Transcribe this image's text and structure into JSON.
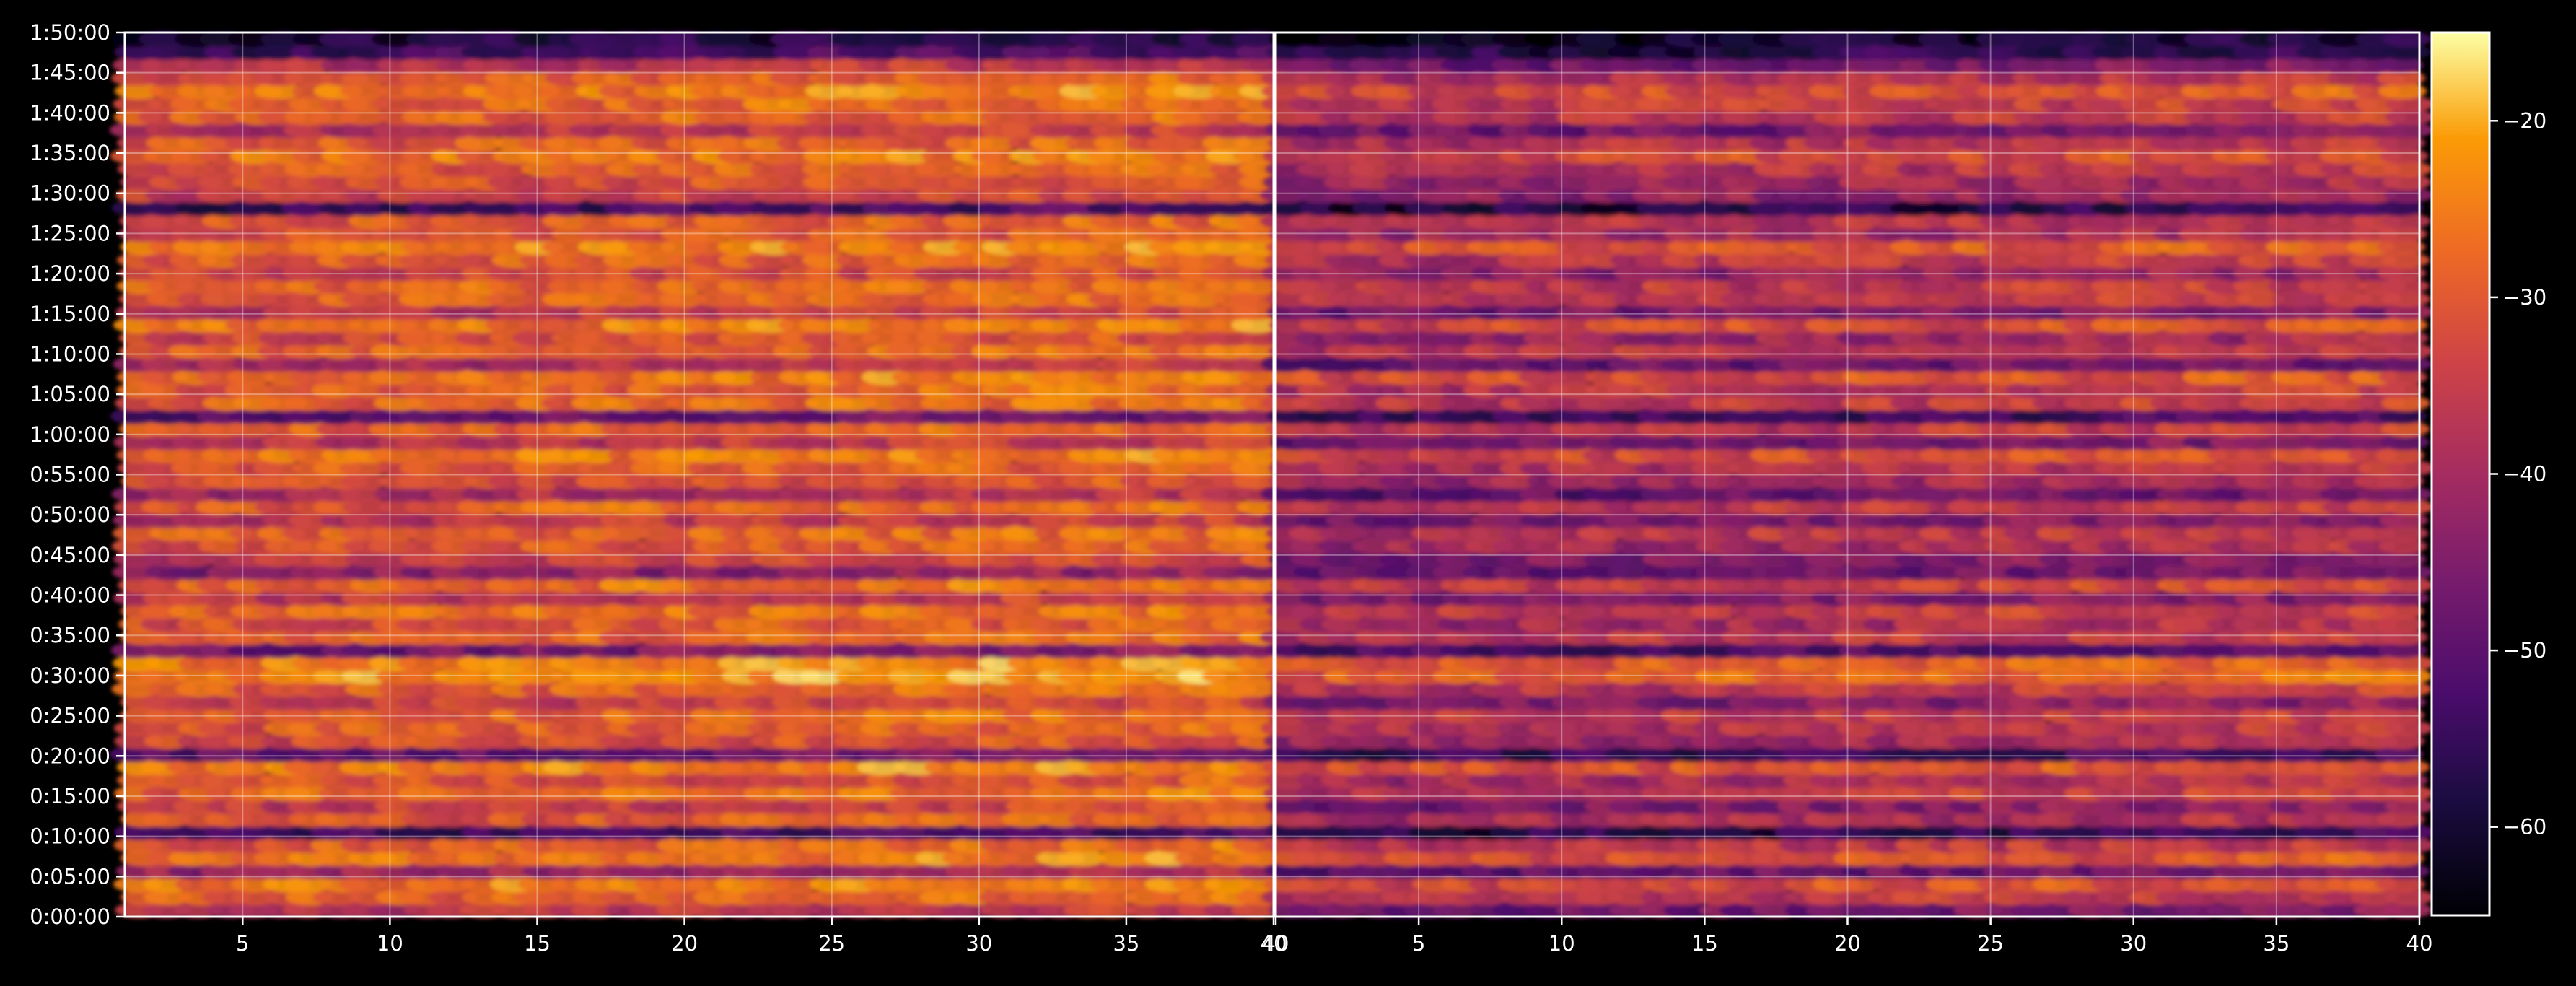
{
  "chart_data": {
    "type": "heatmap",
    "panels": [
      {
        "name": "",
        "xlim": [
          1,
          40
        ],
        "x_ticks": [
          5,
          10,
          15,
          20,
          25,
          30,
          35,
          40
        ],
        "x_tick_labels": [
          "5",
          "10",
          "15",
          "20",
          "25",
          "30",
          "35",
          "40"
        ],
        "ylim_seconds": [
          0,
          6600
        ],
        "grid": true
      },
      {
        "name": "",
        "xlim": [
          0,
          40
        ],
        "x_ticks": [
          5,
          10,
          15,
          20,
          25,
          30,
          35,
          40
        ],
        "x_tick_labels": [
          "40",
          "5",
          "10",
          "15",
          "20",
          "25",
          "30",
          "35",
          "40"
        ],
        "ylim_seconds": [
          0,
          6600
        ],
        "grid": true
      }
    ],
    "y_tick_labels": [
      "0:00:00",
      "0:05:00",
      "0:10:00",
      "0:15:00",
      "0:20:00",
      "0:25:00",
      "0:30:00",
      "0:35:00",
      "0:40:00",
      "0:45:00",
      "0:50:00",
      "0:55:00",
      "1:00:00",
      "1:05:00",
      "1:10:00",
      "1:15:00",
      "1:20:00",
      "1:25:00",
      "1:30:00",
      "1:35:00",
      "1:40:00",
      "1:45:00",
      "1:50:00"
    ],
    "colorbar": {
      "range": [
        -65,
        -15
      ],
      "ticks": [
        -60,
        -50,
        -40,
        -30,
        -20
      ],
      "tick_labels": [
        "−60",
        "−50",
        "−40",
        "−30",
        "−20"
      ],
      "colormap": "inferno"
    },
    "row_levels_note": "Row-wise intensity in dB estimated from color bands, bottom (0:00:00) to top (1:50:00)",
    "row_levels": [
      -38,
      -30,
      -26,
      -42,
      -27,
      -30,
      -55,
      -32,
      -36,
      -29,
      -33,
      -26,
      -50,
      -33,
      -31,
      -29,
      -36,
      -30,
      -24,
      -25,
      -47,
      -30,
      -32,
      -29,
      -37,
      -28,
      -45,
      -36,
      -32,
      -30,
      -37,
      -30,
      -40,
      -33,
      -31,
      -27,
      -38,
      -30,
      -50,
      -29,
      -30,
      -27,
      -40,
      -30,
      -34,
      -27,
      -37,
      -30,
      -29,
      -35,
      -30,
      -26,
      -33,
      -31,
      -55,
      -35,
      -33,
      -31,
      -27,
      -31,
      -38,
      -30,
      -29,
      -27,
      -31,
      -38,
      -55,
      -60
    ],
    "row_offsets_panel2": [
      -10,
      -8,
      -7,
      -8,
      -6,
      -8,
      -3,
      -9,
      -10,
      -8,
      -8,
      -6,
      -6,
      -9,
      -8,
      -8,
      -10,
      -8,
      -6,
      -6,
      -6,
      -8,
      -9,
      -8,
      -10,
      -8,
      -5,
      -10,
      -9,
      -8,
      -10,
      -8,
      -10,
      -9,
      -8,
      -7,
      -10,
      -8,
      -6,
      -8,
      -8,
      -6,
      -10,
      -8,
      -9,
      -7,
      -10,
      -8,
      -8,
      -9,
      -8,
      -6,
      -9,
      -8,
      -4,
      -9,
      -9,
      -8,
      -7,
      -8,
      -10,
      -8,
      -8,
      -6,
      -8,
      -10,
      -3,
      -2
    ]
  }
}
